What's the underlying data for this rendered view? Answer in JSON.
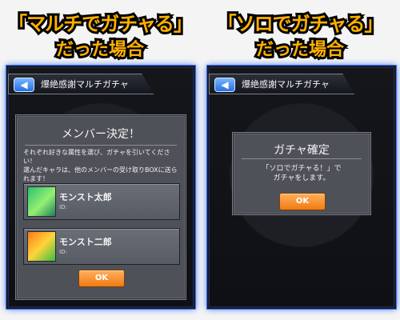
{
  "labels": {
    "left_heading_1": "「マルチでガチャる」",
    "left_heading_2": "だった場合",
    "right_heading_1": "「ソロでガチャる」",
    "right_heading_2": "だった場合"
  },
  "left_panel": {
    "back_icon": "back-arrow-icon",
    "topbar_title": "爆絶感謝マルチガチャ",
    "dialog": {
      "title": "メンバー決定！",
      "body": "それぞれ好きな属性を選び、ガチャを引いてください！\n選んだキャラは、他のメンバーの受け取りBOXに送られます！",
      "members": [
        {
          "name": "モンスト太郎",
          "id_label": "ID:"
        },
        {
          "name": "モンスト二郎",
          "id_label": "ID:"
        }
      ],
      "ok_label": "OK"
    }
  },
  "right_panel": {
    "back_icon": "back-arrow-icon",
    "topbar_title": "爆絶感謝マルチガチャ",
    "dialog": {
      "title": "ガチャ確定",
      "body": "「ソロでガチャる！」で\nガチャをします。",
      "ok_label": "OK"
    }
  }
}
